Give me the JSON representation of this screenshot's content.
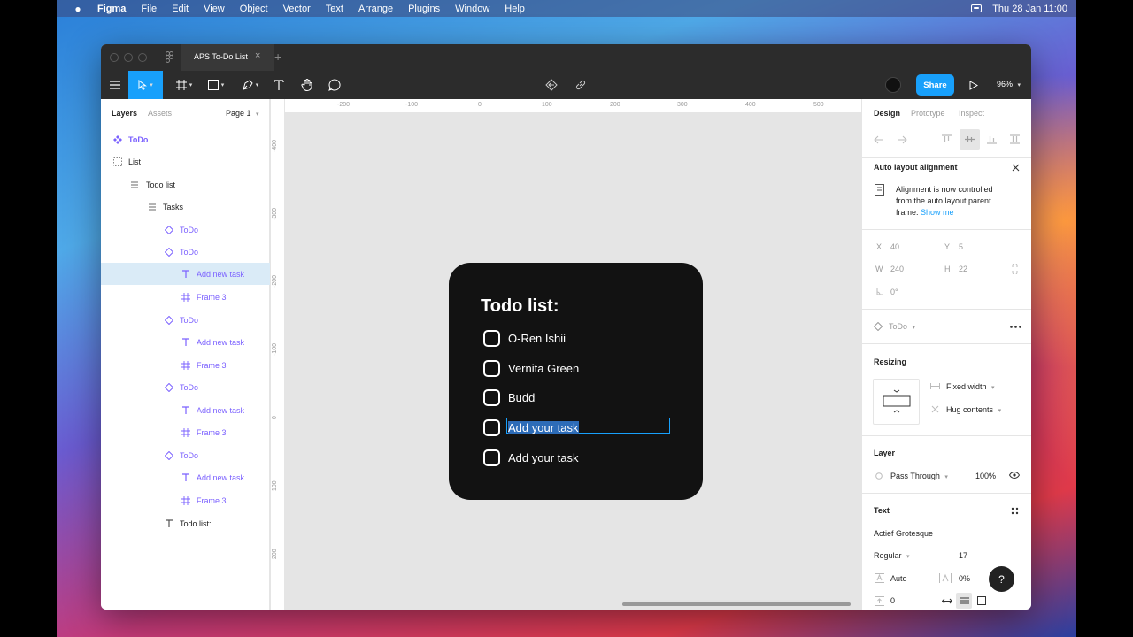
{
  "menubar": {
    "app": "Figma",
    "items": [
      "File",
      "Edit",
      "View",
      "Object",
      "Vector",
      "Text",
      "Arrange",
      "Plugins",
      "Window",
      "Help"
    ],
    "datetime": "Thu 28 Jan  11:00"
  },
  "window": {
    "tab_title": "APS To-Do List"
  },
  "toolbar": {
    "share_label": "Share",
    "zoom": "96%"
  },
  "left_panel": {
    "tab_layers": "Layers",
    "tab_assets": "Assets",
    "page": "Page 1",
    "layers": [
      {
        "name": "ToDo",
        "type": "component"
      },
      {
        "name": "List",
        "type": "frame"
      },
      {
        "name": "Todo list",
        "type": "autolayout"
      },
      {
        "name": "Tasks",
        "type": "autolayout"
      },
      {
        "name": "ToDo",
        "type": "instance"
      },
      {
        "name": "ToDo",
        "type": "instance"
      },
      {
        "name": "Add new task",
        "type": "text",
        "selected": true
      },
      {
        "name": "Frame 3",
        "type": "frame"
      },
      {
        "name": "ToDo",
        "type": "instance"
      },
      {
        "name": "Add new task",
        "type": "text"
      },
      {
        "name": "Frame 3",
        "type": "frame"
      },
      {
        "name": "ToDo",
        "type": "instance"
      },
      {
        "name": "Add new task",
        "type": "text"
      },
      {
        "name": "Frame 3",
        "type": "frame"
      },
      {
        "name": "ToDo",
        "type": "instance"
      },
      {
        "name": "Add new task",
        "type": "text"
      },
      {
        "name": "Frame 3",
        "type": "frame"
      },
      {
        "name": "Todo list:",
        "type": "text"
      }
    ]
  },
  "canvas": {
    "ruler_top": [
      "-200",
      "-100",
      "0",
      "100",
      "200",
      "300",
      "400",
      "500"
    ],
    "ruler_left": [
      "-400",
      "-300",
      "-200",
      "-100",
      "0",
      "100",
      "200"
    ],
    "card": {
      "title": "Todo list:",
      "tasks": [
        "O-Ren Ishii",
        "Vernita Green",
        "Budd",
        "Add your task",
        "Add your task"
      ],
      "editing_index": 3
    }
  },
  "right_panel": {
    "tab_design": "Design",
    "tab_prototype": "Prototype",
    "tab_inspect": "Inspect",
    "notice_title": "Auto layout alignment",
    "notice_line1": "Alignment is now controlled",
    "notice_line2": "from the auto layout parent",
    "notice_line3": "frame.",
    "notice_link": "Show me",
    "x_label": "X",
    "x_value": "40",
    "y_label": "Y",
    "y_value": "5",
    "w_label": "W",
    "w_value": "240",
    "h_label": "H",
    "h_value": "22",
    "rotation": "0°",
    "component_name": "ToDo",
    "resizing_title": "Resizing",
    "width_mode": "Fixed width",
    "height_mode": "Hug contents",
    "layer_title": "Layer",
    "blend_mode": "Pass Through",
    "opacity": "100%",
    "text_title": "Text",
    "font_family": "Actief Grotesque",
    "font_weight": "Regular",
    "font_size": "17",
    "line_height": "Auto",
    "letter_spacing": "0%",
    "paragraph_spacing": "0",
    "help": "?"
  }
}
